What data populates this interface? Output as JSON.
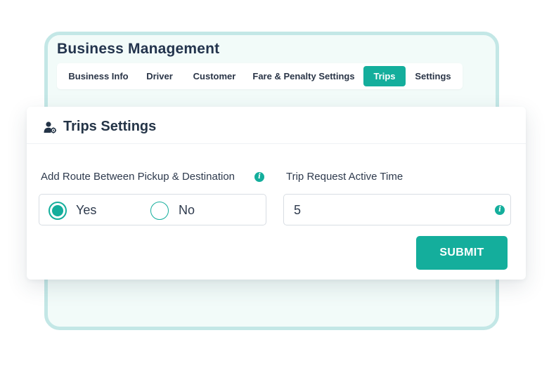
{
  "background": {
    "title": "Business Management",
    "tabs": [
      {
        "label": "Business Info",
        "active": false
      },
      {
        "label": "Driver",
        "active": false
      },
      {
        "label": "Customer",
        "active": false
      },
      {
        "label": "Fare & Penalty Settings",
        "active": false
      },
      {
        "label": "Trips",
        "active": true
      },
      {
        "label": "Settings",
        "active": false
      }
    ]
  },
  "trips_settings": {
    "header_icon": "user-gear-icon",
    "title": "Trips Settings",
    "route_field": {
      "label": "Add Route Between Pickup & Destination",
      "info_icon": "info-icon",
      "options": [
        {
          "label": "Yes",
          "selected": true
        },
        {
          "label": "No",
          "selected": false
        }
      ]
    },
    "active_time_field": {
      "label": "Trip Request Active Time",
      "value": "5",
      "info_icon": "info-icon"
    },
    "submit_label": "SUBMIT"
  },
  "colors": {
    "accent": "#14ae9c",
    "card_border": "#c3e7e6",
    "card_background": "#f2fbf9",
    "heading": "#23344d"
  }
}
